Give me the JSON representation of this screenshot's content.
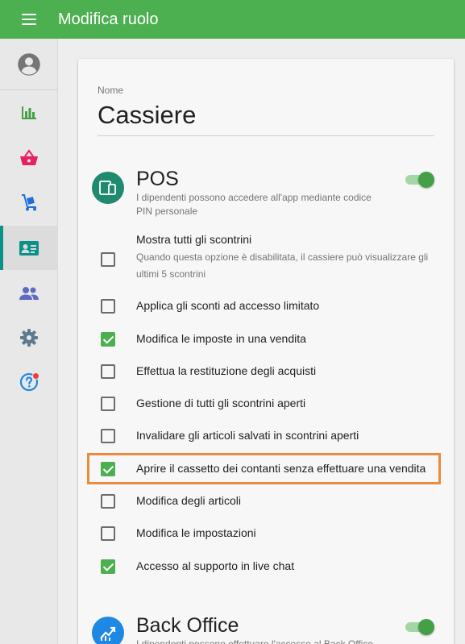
{
  "header": {
    "title": "Modifica ruolo"
  },
  "colors": {
    "primary": "#4caf50",
    "accent_teal": "#0a9189",
    "highlight": "#ee8a3b",
    "badge": "#ef3b3b"
  },
  "sidebar": {
    "items": [
      {
        "icon": "account-circle-icon",
        "active": false
      },
      {
        "icon": "bar-chart-icon",
        "active": false
      },
      {
        "icon": "basket-icon",
        "active": false
      },
      {
        "icon": "hand-truck-icon",
        "active": false
      },
      {
        "icon": "employee-card-icon",
        "active": true
      },
      {
        "icon": "people-icon",
        "active": false
      },
      {
        "icon": "gear-icon",
        "active": false
      },
      {
        "icon": "help-icon",
        "active": false,
        "badge": true
      }
    ]
  },
  "form": {
    "name_label": "Nome",
    "name_value": "Cassiere"
  },
  "pos": {
    "title": "POS",
    "description_line1": "I dipendenti possono accedere all'app mediante codice",
    "description_line2": "PIN personale",
    "enabled": true,
    "permissions": [
      {
        "label": "Mostra tutti gli scontrini",
        "checked": false,
        "sub_line1": "Quando questa opzione è disabilitata, il cassiere può visualizzare gli",
        "sub_line2": "ultimi 5 scontrini"
      },
      {
        "label": "Applica gli sconti ad accesso limitato",
        "checked": false
      },
      {
        "label": "Modifica le imposte in una vendita",
        "checked": true
      },
      {
        "label": "Effettua la restituzione degli acquisti",
        "checked": false
      },
      {
        "label": "Gestione di tutti gli scontrini aperti",
        "checked": false
      },
      {
        "label": "Invalidare gli articoli salvati in scontrini aperti",
        "checked": false
      },
      {
        "label": "Aprire il cassetto dei contanti senza effettuare una vendita",
        "checked": true
      },
      {
        "label": "Modifica degli articoli",
        "checked": false
      },
      {
        "label": "Modifica le impostazioni",
        "checked": false
      },
      {
        "label": "Accesso al supporto in live chat",
        "checked": true
      }
    ]
  },
  "back_office": {
    "title": "Back Office",
    "description_partial": "I dipendenti possono effettuare l'accesso al Back Office",
    "enabled": true
  }
}
